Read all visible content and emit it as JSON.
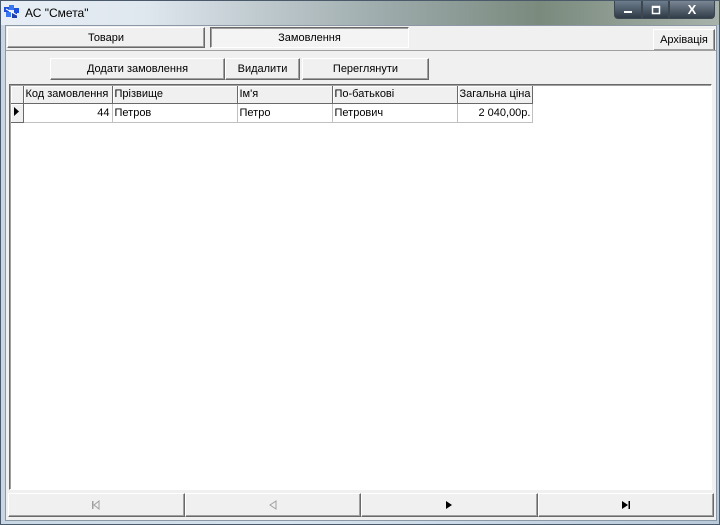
{
  "window": {
    "title": "АС \"Смета\"",
    "min_symbol": "—",
    "max_symbol": "□",
    "close_symbol": "X"
  },
  "tabs": [
    {
      "label": "Товари",
      "selected": false
    },
    {
      "label": "Замовлення",
      "selected": true
    }
  ],
  "archive_button": "Архівація",
  "toolbar": {
    "add_label": "Додати замовлення",
    "delete_label": "Видалити",
    "view_label": "Переглянути"
  },
  "grid": {
    "columns": [
      "Код замовлення",
      "Прізвище",
      "Ім'я",
      "По-батькові",
      "Загальна ціна"
    ],
    "rows": [
      {
        "code": "44",
        "surname": "Петров",
        "name": "Петро",
        "patronymic": "Петрович",
        "total": "2 040,00р."
      }
    ]
  },
  "navigator": {
    "first_icon": "first-record-icon",
    "prior_icon": "prior-record-icon",
    "next_icon": "next-record-icon",
    "last_icon": "last-record-icon"
  }
}
